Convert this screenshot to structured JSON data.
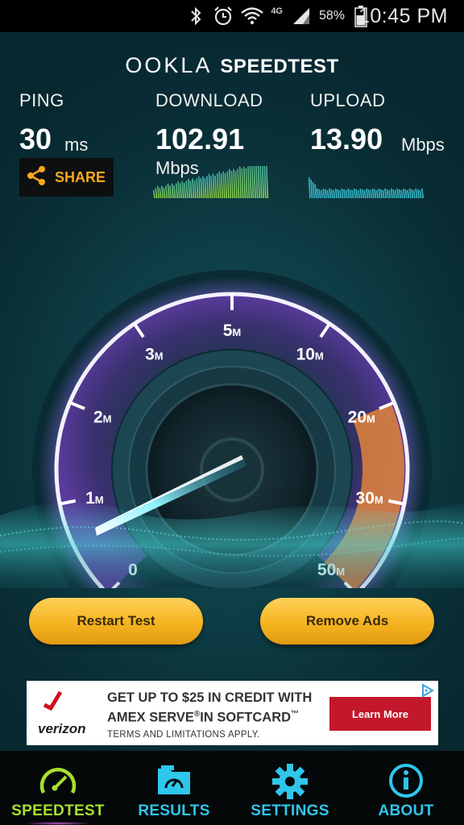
{
  "status_bar": {
    "time": "10:45 PM",
    "battery_percent": "58%",
    "network": "4G",
    "icons": [
      "bluetooth-icon",
      "alarm-icon",
      "wifi-icon",
      "signal-icon",
      "battery-icon"
    ]
  },
  "app": {
    "logo_left": "OOKLA",
    "logo_right": "SPEEDTEST"
  },
  "metrics": {
    "ping": {
      "label": "PING",
      "value": "30",
      "unit": "ms"
    },
    "download": {
      "label": "DOWNLOAD",
      "value": "102.91",
      "unit": "Mbps"
    },
    "upload": {
      "label": "UPLOAD",
      "value": "13.90",
      "unit": "Mbps"
    }
  },
  "share_button": {
    "label": "SHARE",
    "icon": "share-icon"
  },
  "gauge": {
    "ticks": [
      {
        "num": "0",
        "unit": ""
      },
      {
        "num": "1",
        "unit": "M"
      },
      {
        "num": "2",
        "unit": "M"
      },
      {
        "num": "3",
        "unit": "M"
      },
      {
        "num": "5",
        "unit": "M"
      },
      {
        "num": "10",
        "unit": "M"
      },
      {
        "num": "20",
        "unit": "M"
      },
      {
        "num": "30",
        "unit": "M"
      },
      {
        "num": "50",
        "unit": "M"
      }
    ],
    "colors": {
      "ring": "#6b3fb4",
      "accent": "#f0953a",
      "needle": "#7fe6ff"
    }
  },
  "buttons": {
    "restart": "Restart Test",
    "remove_ads": "Remove Ads",
    "color": "#f5b320"
  },
  "ad": {
    "brand": "verizon",
    "line1": "GET UP TO $25 IN CREDIT WITH",
    "line2_a": "AMEX SERVE",
    "line2_b": "IN SOFTCARD",
    "line3": "TERMS AND LIMITATIONS APPLY.",
    "cta": "Learn More"
  },
  "tabs": [
    {
      "label": "SPEEDTEST",
      "icon": "speedometer-icon",
      "active": true
    },
    {
      "label": "RESULTS",
      "icon": "folder-icon",
      "active": false
    },
    {
      "label": "SETTINGS",
      "icon": "gear-icon",
      "active": false
    },
    {
      "label": "ABOUT",
      "icon": "info-icon",
      "active": false
    }
  ]
}
